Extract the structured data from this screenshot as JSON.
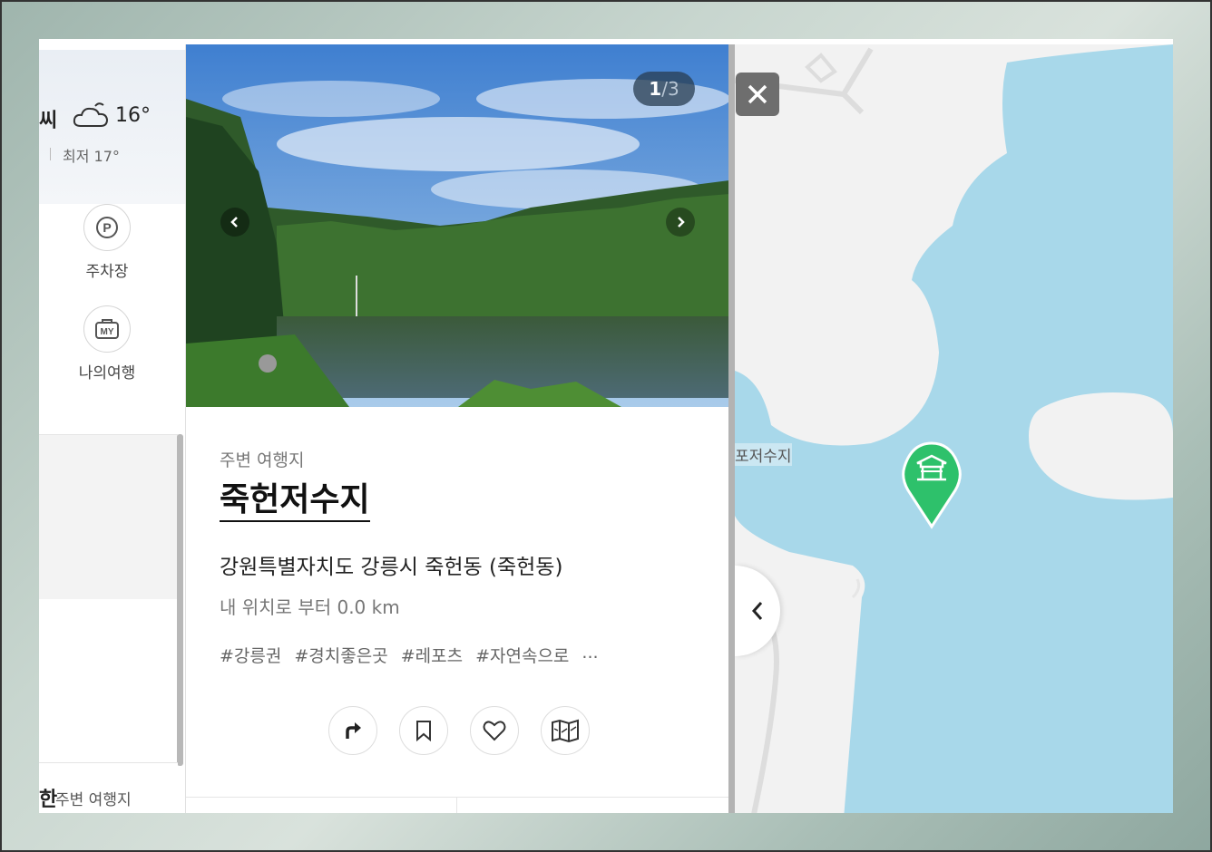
{
  "sidebar": {
    "weather": {
      "label": "씨",
      "icon": "cloud-icon",
      "temp": "16°",
      "low": "최저 17°"
    },
    "shortcuts": [
      {
        "label": "주차장",
        "icon": "parking-icon"
      },
      {
        "label": "나의여행",
        "icon": "my-trip-icon"
      }
    ],
    "bottom": {
      "bold": "한",
      "text": "주변 여행지"
    }
  },
  "detail": {
    "counter": {
      "current": "1",
      "total": "/3"
    },
    "subhead": "주변 여행지",
    "title": "죽헌저수지",
    "address": "강원특별자치도 강릉시 죽헌동 (죽헌동)",
    "distance": "내 위치로 부터 0.0 km",
    "tags": [
      "#강릉권",
      "#경치좋은곳",
      "#레포츠",
      "#자연속으로",
      "..."
    ],
    "actions": [
      {
        "name": "directions-button",
        "icon": "turn-right-icon"
      },
      {
        "name": "bookmark-button",
        "icon": "bookmark-icon"
      },
      {
        "name": "like-button",
        "icon": "heart-icon"
      },
      {
        "name": "map-button",
        "icon": "map-icon"
      }
    ]
  },
  "map": {
    "place_label": "포저수지",
    "marker_icon": "pavilion-icon",
    "water_color": "#a8d8ea",
    "marker_color": "#2ec16b"
  }
}
